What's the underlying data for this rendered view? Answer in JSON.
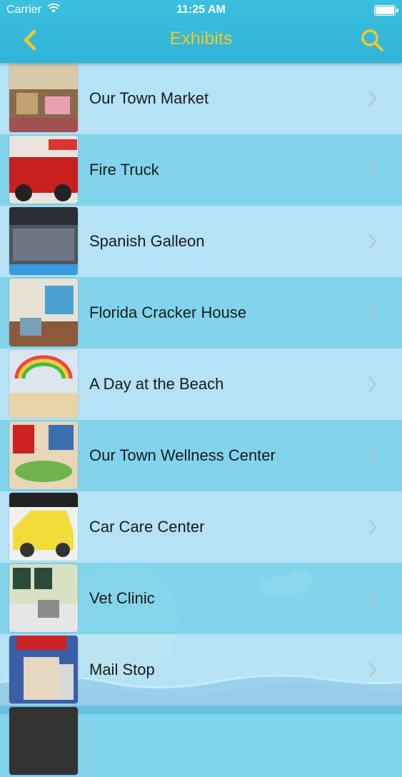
{
  "status_bar": {
    "carrier": "Carrier",
    "time": "11:25 AM"
  },
  "nav": {
    "title": "Exhibits",
    "back_icon": "chevron-left-icon",
    "search_icon": "search-icon",
    "accent_color": "#f3c927",
    "bar_color": "#37bbdd"
  },
  "exhibits": [
    {
      "name": "Our Town Market"
    },
    {
      "name": "Fire Truck"
    },
    {
      "name": "Spanish Galleon"
    },
    {
      "name": "Florida Cracker House"
    },
    {
      "name": "A Day at the Beach"
    },
    {
      "name": "Our Town Wellness Center"
    },
    {
      "name": "Car Care Center"
    },
    {
      "name": "Vet Clinic"
    },
    {
      "name": "Mail Stop"
    },
    {
      "name": ""
    }
  ]
}
